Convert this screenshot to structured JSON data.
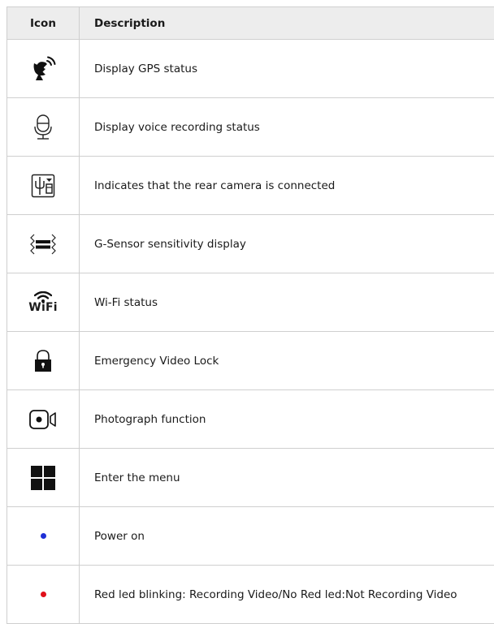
{
  "header": {
    "icon_col": "Icon",
    "desc_col": "Description"
  },
  "rows": [
    {
      "icon": "satellite-dish-icon",
      "description": "Display GPS status"
    },
    {
      "icon": "microphone-icon",
      "description": "Display voice recording status"
    },
    {
      "icon": "rear-camera-connector-icon",
      "description": "Indicates that the rear camera is connected"
    },
    {
      "icon": "g-sensor-icon",
      "description": "G-Sensor sensitivity display"
    },
    {
      "icon": "wifi-icon",
      "icon_text": "WiFi",
      "description": "Wi-Fi status"
    },
    {
      "icon": "lock-icon",
      "description": "Emergency Video Lock"
    },
    {
      "icon": "camera-record-icon",
      "description": "Photograph function"
    },
    {
      "icon": "menu-grid-icon",
      "description": "Enter the menu"
    },
    {
      "icon": "blue-dot-icon",
      "color": "#1f2fd6",
      "description": "Power on"
    },
    {
      "icon": "red-dot-icon",
      "color": "#e0101a",
      "description": "Red led blinking: Recording Video/No Red led:Not Recording Video"
    }
  ]
}
